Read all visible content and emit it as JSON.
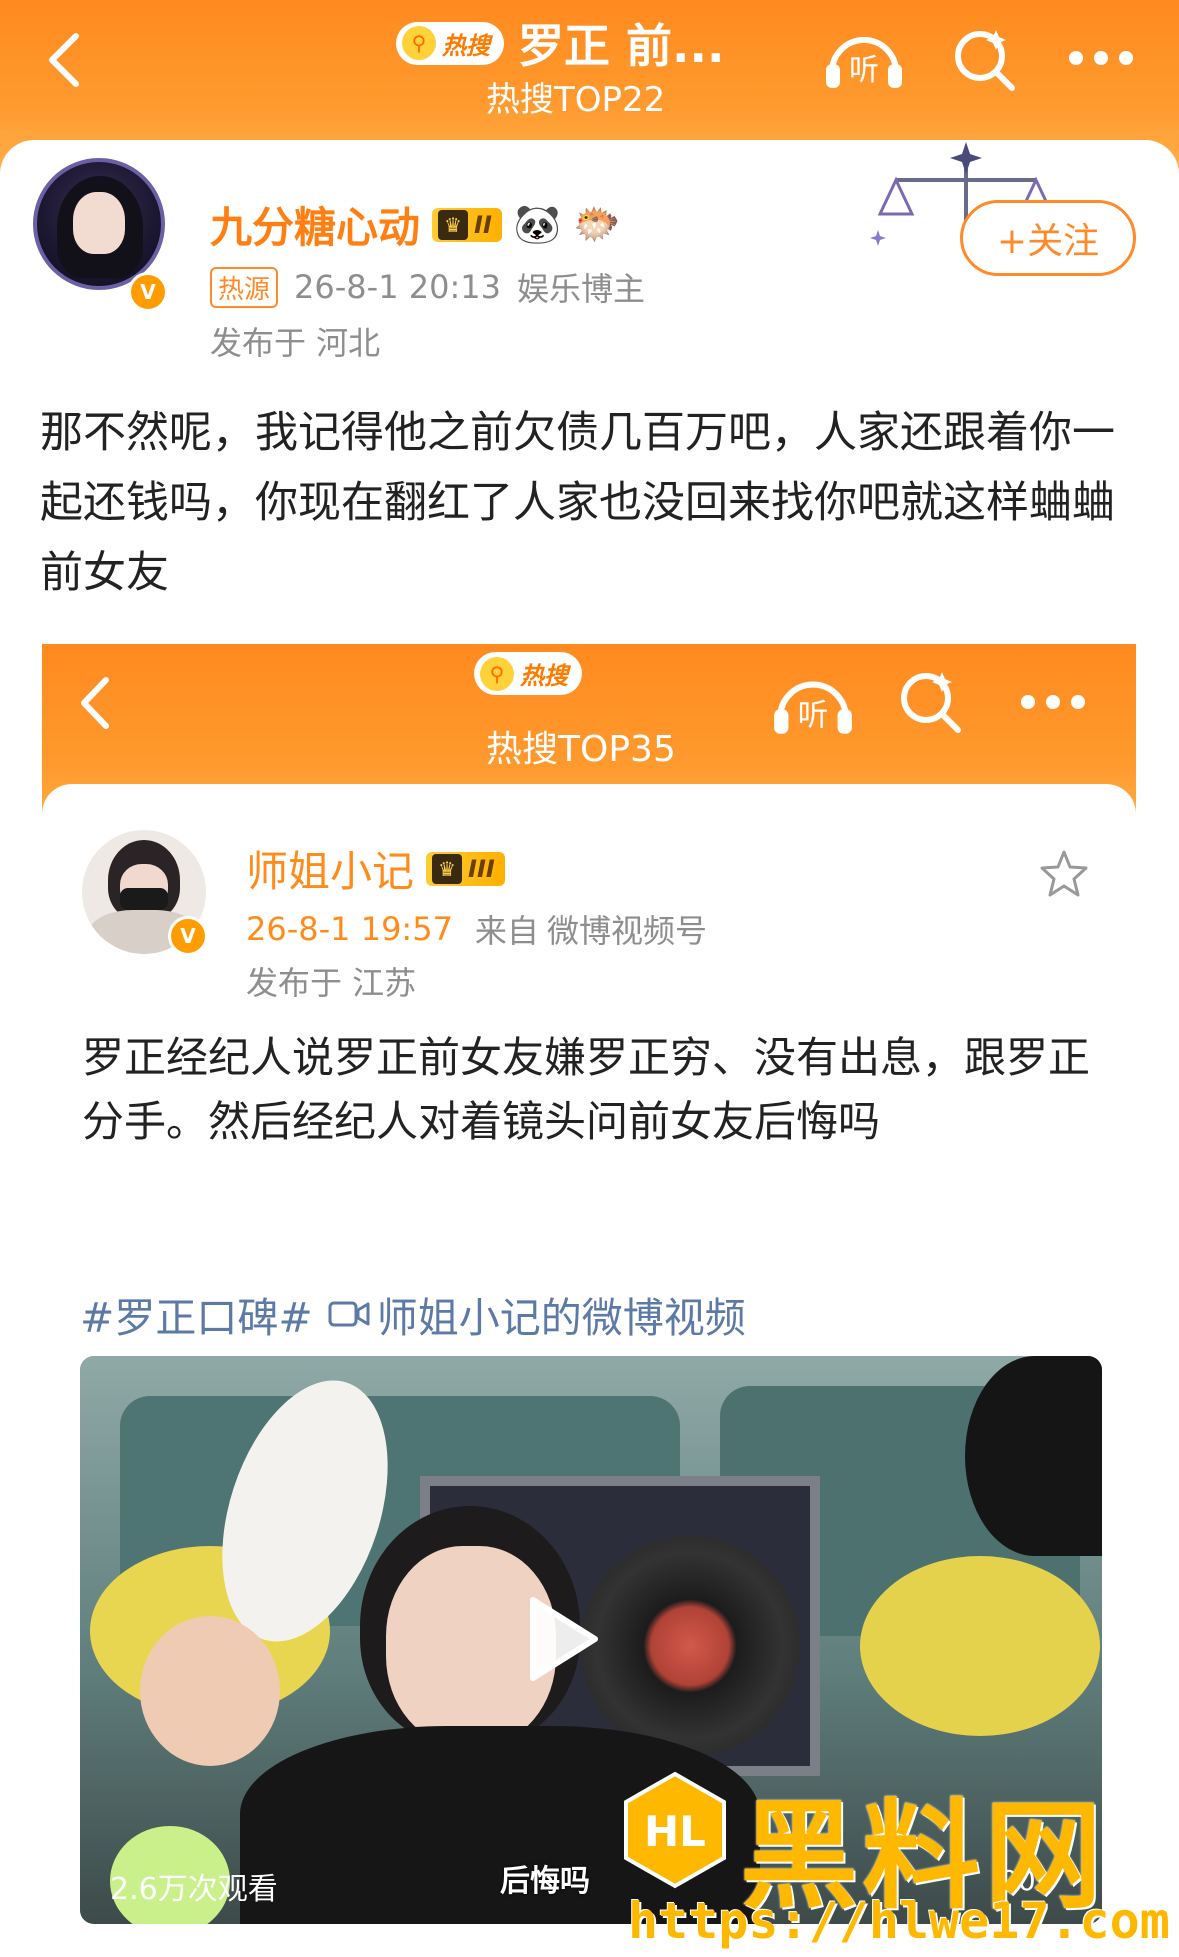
{
  "header": {
    "hot_badge": "热搜",
    "title": "罗正 前...",
    "subtitle": "热搜TOP22",
    "listen_icon_label": "听"
  },
  "post": {
    "username": "九分糖心动",
    "level": "II",
    "source_tag": "热源",
    "time": "26-8-1 20:13",
    "category": "娱乐博主",
    "location": "发布于 河北",
    "follow_label": "+关注",
    "text": "那不然呢，我记得他之前欠债几百万吧，人家还跟着你一起还钱吗，你现在翻红了人家也没回来找你吧就这样蛐蛐前女友"
  },
  "embedded": {
    "hot_badge": "热搜",
    "subtitle": "热搜TOP35",
    "listen_icon_label": "听",
    "username": "师姐小记",
    "level": "III",
    "time": "26-8-1 19:57",
    "source_prefix": "来自",
    "source": "微博视频号",
    "location": "发布于 江苏",
    "text": "罗正经纪人说罗正前女友嫌罗正穷、没有出息，跟罗正分手。然后经纪人对着镜头问前女友后悔吗",
    "hashtag": "#罗正口碑#",
    "video_link": "师姐小记的微博视频",
    "views": "2.6万次观看",
    "caption": "后悔吗",
    "duration": "00:"
  },
  "watermark": {
    "brand": "黑料网",
    "logo": "HL",
    "url": "https://hlwe17.com"
  }
}
